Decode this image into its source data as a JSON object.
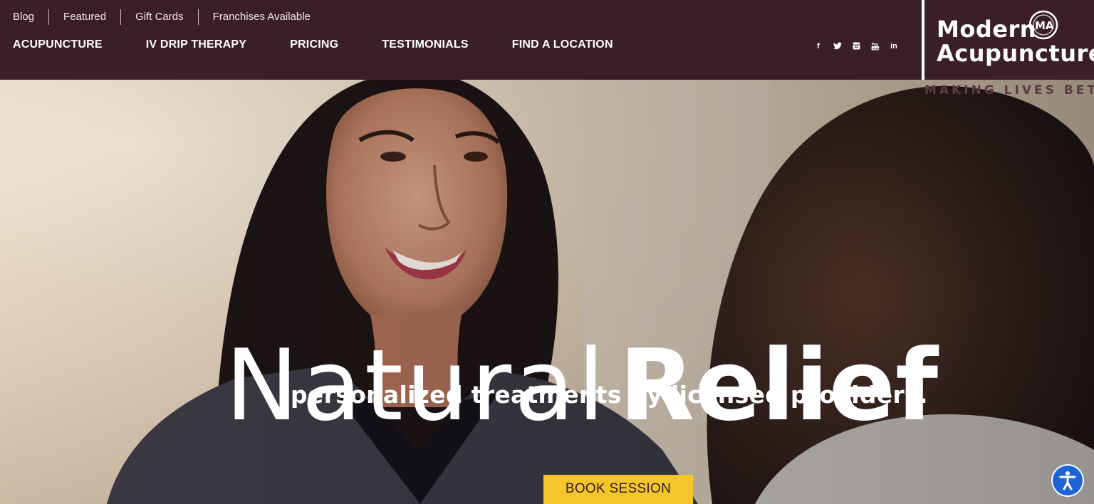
{
  "utility_nav": [
    "Blog",
    "Featured",
    "Gift Cards",
    "Franchises Available"
  ],
  "main_nav": [
    "ACUPUNCTURE",
    "IV DRIP THERAPY",
    "PRICING",
    "TESTIMONIALS",
    "FIND A LOCATION"
  ],
  "social": {
    "facebook": "f",
    "twitter": "twitter-icon",
    "instagram": "instagram-icon",
    "youtube": "youtube-icon",
    "linkedin": "in"
  },
  "logo": {
    "line1": "Modern",
    "line2": "Acupuncture",
    "mark": "MA"
  },
  "tagline": "MAKING LIVES BETTER",
  "hero": {
    "title_light": "Natural",
    "title_bold": "Relief",
    "subtitle": "personalized treatments by licensed providers.",
    "cta": "BOOK SESSION"
  },
  "colors": {
    "header_bg": "#3a1f29",
    "cta_bg": "#f4c62a",
    "accessibility_bg": "#1e63d6"
  },
  "accessibility": {
    "icon": "accessibility-icon"
  }
}
